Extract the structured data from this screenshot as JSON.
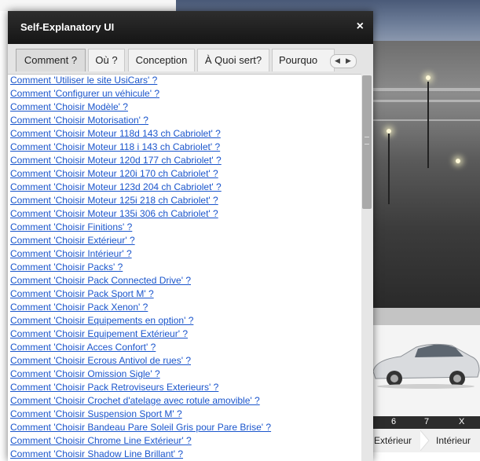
{
  "dialog": {
    "title": "Self-Explanatory UI",
    "close_label": "×"
  },
  "tabs": [
    {
      "label": "Comment ?",
      "active": true
    },
    {
      "label": "Où ?",
      "active": false
    },
    {
      "label": "Conception",
      "active": false
    },
    {
      "label": "À Quoi sert?",
      "active": false
    },
    {
      "label": "Pourquo",
      "active": false
    }
  ],
  "tab_scroll": {
    "left": "◀",
    "right": "▶"
  },
  "links": [
    "Comment 'Utiliser le site UsiCars' ?",
    "Comment 'Configurer un véhicule' ?",
    "Comment 'Choisir Modèle' ?",
    "Comment 'Choisir Motorisation' ?",
    "Comment 'Choisir Moteur 118d 143 ch Cabriolet' ?",
    "Comment 'Choisir Moteur 118 i 143 ch Cabriolet' ?",
    "Comment 'Choisir Moteur 120d 177 ch Cabriolet' ?",
    "Comment 'Choisir Moteur 120i 170 ch Cabriolet' ?",
    "Comment 'Choisir Moteur 123d 204 ch Cabriolet' ?",
    "Comment 'Choisir Moteur 125i 218 ch Cabriolet' ?",
    "Comment 'Choisir Moteur 135i 306 ch Cabriolet' ?",
    "Comment 'Choisir Finitions' ?",
    "Comment 'Choisir Extérieur' ?",
    "Comment 'Choisir Intérieur' ?",
    "Comment 'Choisir Packs' ?",
    "Comment 'Choisir Pack Connected Drive' ?",
    "Comment 'Choisir Pack Sport M' ?",
    "Comment 'Choisir Pack Xenon' ?",
    "Comment 'Choisir Equipements en option' ?",
    "Comment 'Choisir Equipement Extérieur' ?",
    "Comment 'Choisir Acces Confort' ?",
    "Comment 'Choisir Ecrous Antivol de rues' ?",
    "Comment 'Choisir Omission Sigle' ?",
    "Comment 'Choisir Pack Retroviseurs Exterieurs' ?",
    "Comment 'Choisir Crochet d'atelage avec rotule amovible' ?",
    "Comment 'Choisir Suspension Sport M' ?",
    "Comment 'Choisir Bandeau Pare Soleil Gris pour Pare Brise' ?",
    "Comment 'Choisir Chrome Line Extérieur' ?",
    "Comment 'Choisir Shadow Line Brillant' ?"
  ],
  "background": {
    "page_numbers": [
      "6",
      "7",
      "X"
    ],
    "nav": {
      "exterieur": "Extérieur",
      "interieur": "Intérieur"
    }
  },
  "colors": {
    "link": "#1a55cc",
    "titlebar": "#1e1e1e",
    "tabbar": "#e4e4e4"
  }
}
